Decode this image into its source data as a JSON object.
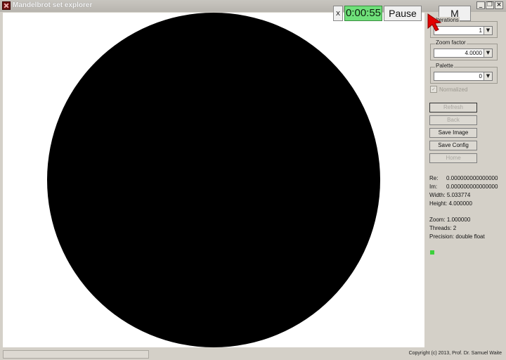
{
  "window": {
    "title": "Mandelbrot set explorer",
    "buttons": [
      "_",
      "❐",
      "×"
    ]
  },
  "overlay": {
    "close": "x",
    "timer": "0:00:55",
    "pause": "Pause",
    "m": "M"
  },
  "controls": {
    "iterations": {
      "label": "Iterations",
      "value": "1"
    },
    "zoom_factor": {
      "label": "Zoom factor",
      "value": "4.0000"
    },
    "palette": {
      "label": "Palette",
      "value": "0"
    },
    "normalized": {
      "label": "Normalized",
      "checked": true
    }
  },
  "buttons": {
    "refresh": "Refresh",
    "back": "Back",
    "save_image": "Save Image",
    "save_config": "Save Config",
    "home": "Home"
  },
  "info": {
    "re_label": "Re:",
    "re_value": "0.000000000000000",
    "im_label": "Im:",
    "im_value": "0.000000000000000",
    "width": "Width:  5.033774",
    "height": "Height: 4.000000",
    "zoom": "Zoom: 1.000000",
    "threads": "Threads: 2",
    "precision": "Precision:  double float"
  },
  "indicator_color": "#3cd03c",
  "status": {
    "copyright": "Copyright (c) 2013, Prof. Dr. Samuel Waite"
  },
  "colors": {
    "timer_bg": "#6fe07a",
    "set_color": "#000000",
    "cursor": "#e10000"
  }
}
